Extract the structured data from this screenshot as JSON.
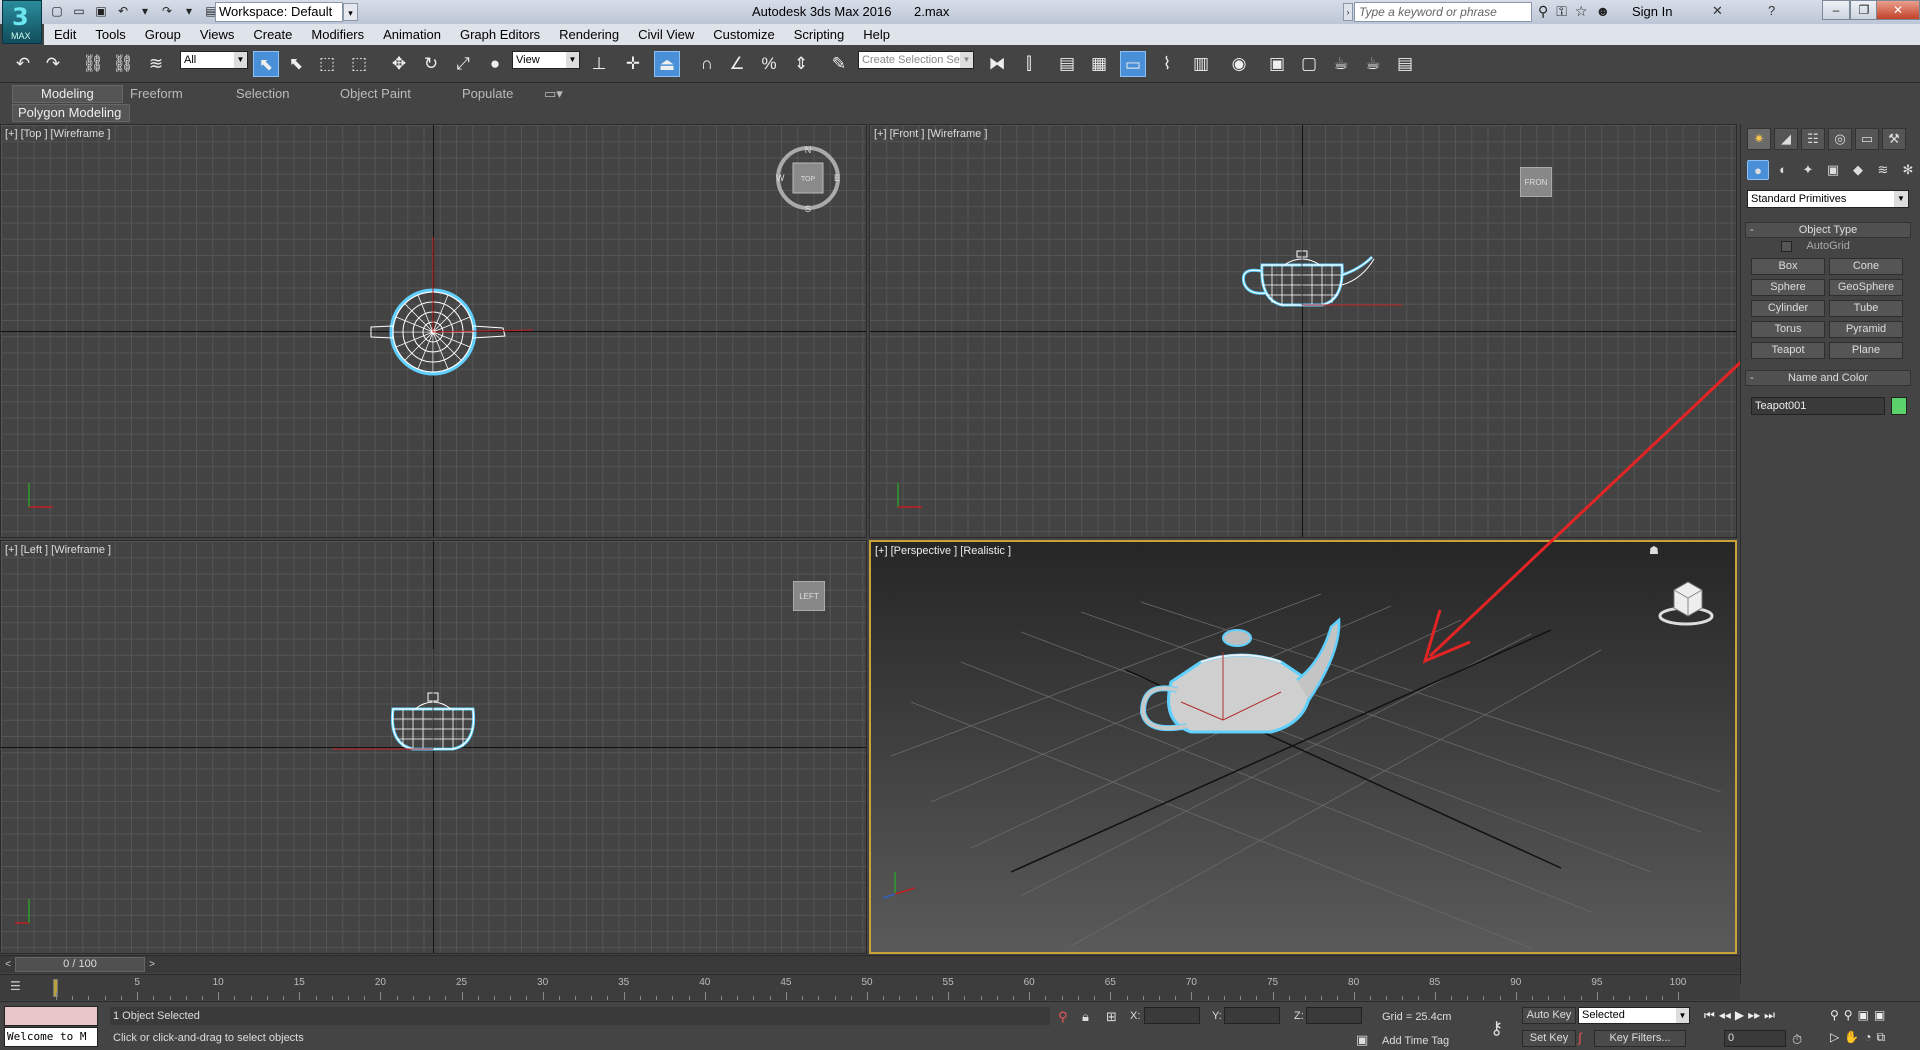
{
  "title": {
    "app": "Autodesk 3ds Max 2016",
    "file": "2.max",
    "workspace": "Workspace: Default",
    "logo_text": "MAX",
    "search_placeholder": "Type a keyword or phrase",
    "sign_in": "Sign In"
  },
  "menu": [
    "Edit",
    "Tools",
    "Group",
    "Views",
    "Create",
    "Modifiers",
    "Animation",
    "Graph Editors",
    "Rendering",
    "Civil View",
    "Customize",
    "Scripting",
    "Help"
  ],
  "toolbar": {
    "filter_value": "All",
    "refcoord_value": "View",
    "selection_set_placeholder": "Create Selection Se"
  },
  "ribbon": {
    "tabs": [
      "Modeling",
      "Freeform",
      "Selection",
      "Object Paint",
      "Populate"
    ],
    "active_tab": "Modeling",
    "sub": "Polygon Modeling"
  },
  "viewports": {
    "top": {
      "label": "[+] [Top ] [Wireframe ]",
      "cube": "TOP"
    },
    "front": {
      "label": "[+] [Front ] [Wireframe ]",
      "cube": "FRON"
    },
    "left": {
      "label": "[+] [Left ] [Wireframe ]",
      "cube": "LEFT"
    },
    "perspective": {
      "label": "[+] [Perspective ] [Realistic ]"
    },
    "compass": {
      "n": "N",
      "s": "S",
      "e": "E",
      "w": "W"
    }
  },
  "command_panel": {
    "category": "Standard Primitives",
    "object_type_title": "Object Type",
    "autogrid": "AutoGrid",
    "buttons": [
      "Box",
      "Cone",
      "Sphere",
      "GeoSphere",
      "Cylinder",
      "Tube",
      "Torus",
      "Pyramid",
      "Teapot",
      "Plane"
    ],
    "name_color_title": "Name and Color",
    "object_name": "Teapot001",
    "object_color": "#5bd26a"
  },
  "timeline": {
    "slider": "0 / 100",
    "ticks": [
      5,
      10,
      15,
      20,
      25,
      30,
      35,
      40,
      45,
      50,
      55,
      60,
      65,
      70,
      75,
      80,
      85,
      90,
      95,
      100
    ]
  },
  "status": {
    "maxscript": "Welcome to M",
    "selection": "1 Object Selected",
    "prompt": "Click or click-and-drag to select objects",
    "x_label": "X:",
    "y_label": "Y:",
    "z_label": "Z:",
    "grid": "Grid = 25.4cm",
    "add_time_tag": "Add Time Tag",
    "auto_key": "Auto Key",
    "set_key": "Set Key",
    "selected_value": "Selected",
    "key_filters": "Key Filters...",
    "frame": "0"
  },
  "colors": {
    "accent": "#4a90d9",
    "selection_outline": "#5fd0ff",
    "annotation": "#e32424",
    "active_viewport_border": "#c7a33a"
  }
}
